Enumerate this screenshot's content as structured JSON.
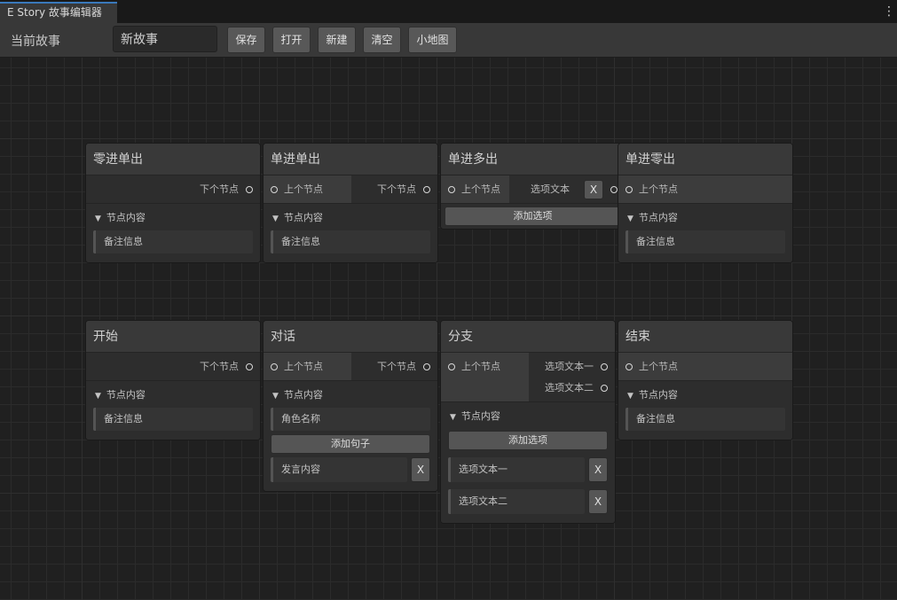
{
  "tab": {
    "title": "E Story 故事编辑器"
  },
  "menu": {
    "glyph": "⋮",
    "icon": "kebab-menu-icon"
  },
  "toolbar": {
    "label": "当前故事",
    "story_name": "新故事",
    "buttons": {
      "save": "保存",
      "open": "打开",
      "new": "新建",
      "clear": "清空",
      "minimap": "小地图"
    }
  },
  "labels": {
    "prev": "上个节点",
    "next": "下个节点",
    "content": "节点内容",
    "note": "备注信息",
    "add_option": "添加选项",
    "x": "X",
    "fold_glyph": "▼"
  },
  "nodes": {
    "zero_in_single_out": {
      "title": "零进单出"
    },
    "single_in_single_out": {
      "title": "单进单出"
    },
    "single_in_multi_out": {
      "title": "单进多出",
      "option": "选项文本"
    },
    "single_in_zero_out": {
      "title": "单进零出"
    },
    "start": {
      "title": "开始"
    },
    "dialogue": {
      "title": "对话",
      "role_name": "角色名称",
      "add_sentence": "添加句子",
      "speech": "发言内容"
    },
    "branch": {
      "title": "分支",
      "option1": "选项文本一",
      "option2": "选项文本二"
    },
    "end": {
      "title": "结束"
    }
  }
}
